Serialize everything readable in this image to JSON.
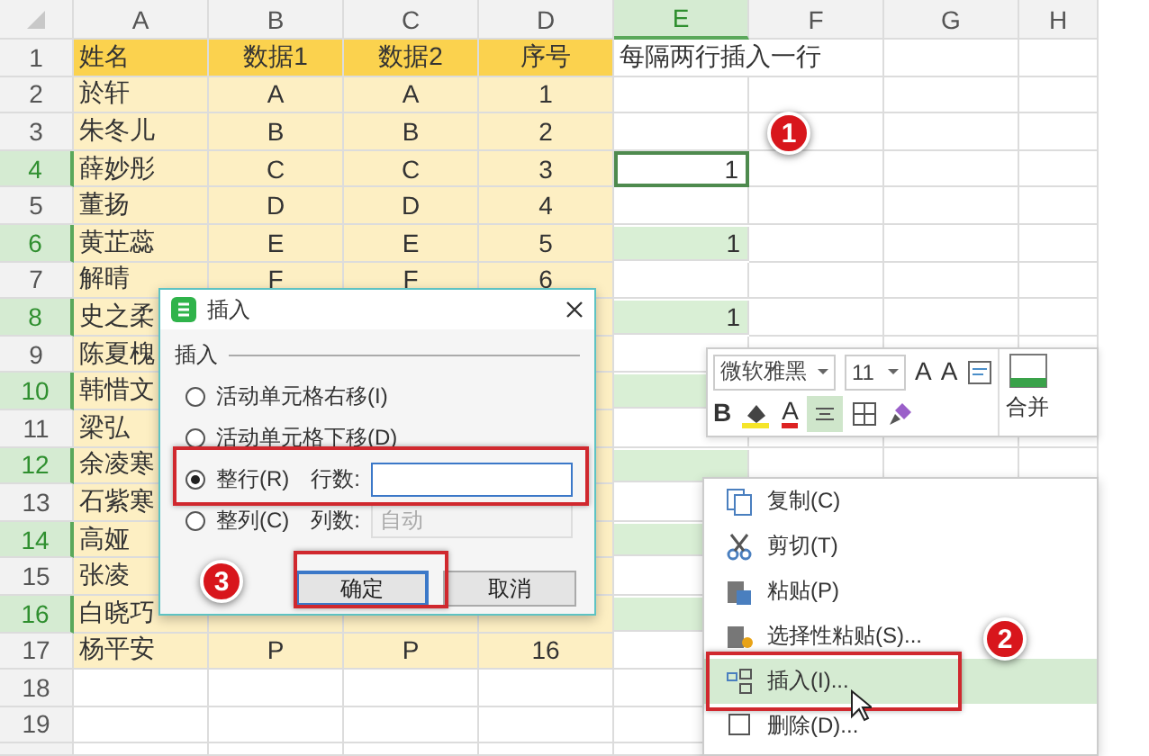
{
  "columns": [
    {
      "label": "A",
      "selected": false
    },
    {
      "label": "B",
      "selected": false
    },
    {
      "label": "C",
      "selected": false
    },
    {
      "label": "D",
      "selected": false
    },
    {
      "label": "E",
      "selected": true
    },
    {
      "label": "F",
      "selected": false
    },
    {
      "label": "G",
      "selected": false
    },
    {
      "label": "H",
      "selected": false
    }
  ],
  "rows": [
    {
      "number": "1",
      "kind": "header",
      "selected": false,
      "active": false,
      "a": "姓名",
      "b": "数据1",
      "c": "数据2",
      "d": "序号",
      "e": "每隔两行插入一行"
    },
    {
      "number": "2",
      "kind": "data",
      "selected": false,
      "active": false,
      "a": "於轩",
      "b": "A",
      "c": "A",
      "d": "1"
    },
    {
      "number": "3",
      "kind": "data",
      "selected": false,
      "active": false,
      "a": "朱冬儿",
      "b": "B",
      "c": "B",
      "d": "2"
    },
    {
      "number": "4",
      "kind": "data",
      "selected": true,
      "active": true,
      "a": "薛妙彤",
      "b": "C",
      "c": "C",
      "d": "3",
      "e": "1"
    },
    {
      "number": "5",
      "kind": "data",
      "selected": false,
      "active": false,
      "a": "董扬",
      "b": "D",
      "c": "D",
      "d": "4"
    },
    {
      "number": "6",
      "kind": "data",
      "selected": true,
      "active": false,
      "a": "黄芷蕊",
      "b": "E",
      "c": "E",
      "d": "5",
      "e": "1"
    },
    {
      "number": "7",
      "kind": "data",
      "selected": false,
      "active": false,
      "a": "解晴",
      "b": "F",
      "c": "F",
      "d": "6"
    },
    {
      "number": "8",
      "kind": "data",
      "selected": true,
      "active": false,
      "a": "史之柔",
      "e": "1"
    },
    {
      "number": "9",
      "kind": "data",
      "selected": false,
      "active": false,
      "a": "陈夏槐"
    },
    {
      "number": "10",
      "kind": "data",
      "selected": true,
      "active": false,
      "a": "韩惜文"
    },
    {
      "number": "11",
      "kind": "data",
      "selected": false,
      "active": false,
      "a": "梁弘"
    },
    {
      "number": "12",
      "kind": "data",
      "selected": true,
      "active": false,
      "a": "余凌寒"
    },
    {
      "number": "13",
      "kind": "data",
      "selected": false,
      "active": false,
      "a": "石紫寒"
    },
    {
      "number": "14",
      "kind": "data",
      "selected": true,
      "active": false,
      "a": "高娅"
    },
    {
      "number": "15",
      "kind": "data",
      "selected": false,
      "active": false,
      "a": "张凌"
    },
    {
      "number": "16",
      "kind": "data",
      "selected": true,
      "active": false,
      "a": "白晓巧"
    },
    {
      "number": "17",
      "kind": "data",
      "selected": false,
      "active": false,
      "a": "杨平安",
      "b": "P",
      "c": "P",
      "d": "16"
    },
    {
      "number": "18",
      "kind": "empty",
      "selected": false,
      "active": false
    },
    {
      "number": "19",
      "kind": "empty",
      "selected": false,
      "active": false
    }
  ],
  "dialog": {
    "title": "插入",
    "section": "插入",
    "options": [
      {
        "label": "活动单元格右移(I)",
        "selected": false
      },
      {
        "label": "活动单元格下移(D)",
        "selected": false
      },
      {
        "label": "整行(R)",
        "selected": true,
        "field_label": "行数:",
        "field_disabled": false
      },
      {
        "label": "整列(C)",
        "selected": false,
        "field_label": "列数:",
        "field_value": "自动",
        "field_disabled": true
      }
    ],
    "buttons": [
      {
        "label": "确定",
        "focused": true
      },
      {
        "label": "取消",
        "focused": false
      }
    ]
  },
  "toolbar": {
    "font": "微软雅黑",
    "size": "11",
    "grow_font": "A",
    "shrink_font": "A",
    "bold": "B",
    "font_color": "A",
    "align_active": true,
    "merge": "合并"
  },
  "menu": [
    {
      "kind": "copy",
      "label": "复制(C)",
      "selected": false
    },
    {
      "kind": "cut",
      "label": "剪切(T)",
      "selected": false
    },
    {
      "kind": "paste",
      "label": "粘贴(P)",
      "selected": false
    },
    {
      "kind": "paste-special",
      "label": "选择性粘贴(S)...",
      "selected": false
    },
    {
      "kind": "insert",
      "label": "插入(I)...",
      "selected": true
    },
    {
      "kind": "delete",
      "label": "删除(D)...",
      "selected": false
    }
  ],
  "steps": [
    {
      "label": "1"
    },
    {
      "label": "2"
    },
    {
      "label": "3"
    }
  ]
}
